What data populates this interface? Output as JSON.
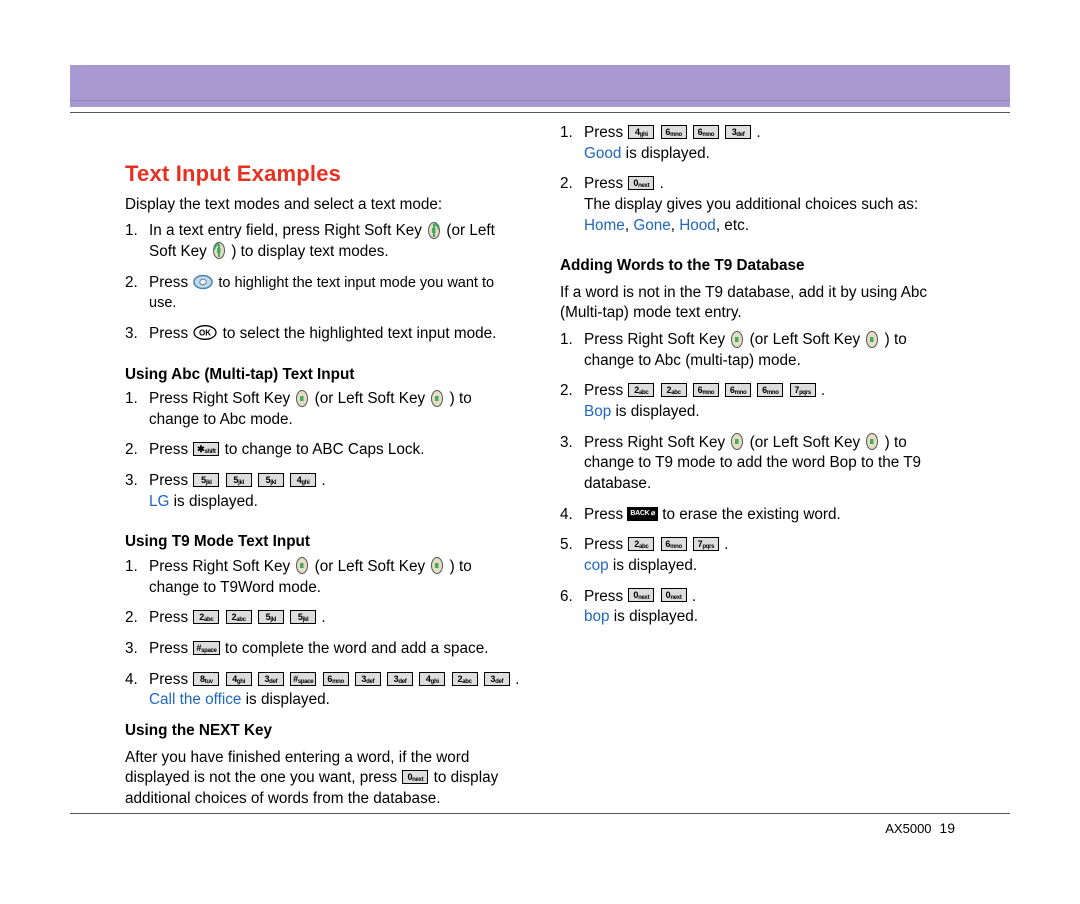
{
  "title": "Text Input Examples",
  "intro": "Display the text modes and select a text mode:",
  "step_text": {
    "in_text_entry_press_rsk": "In a text entry field, press Right Soft Key ",
    "or_left_soft_key": " (or Left Soft Key ",
    "to_display_text_modes": " ) to display text modes.",
    "press": "Press ",
    "to_highlight_mode": " to highlight the text input mode you want to use.",
    "to_select_mode": " to select the highlighted text input mode.",
    "press_rsk": "Press Right Soft Key ",
    "or_lsk": " (or Left Soft Key ",
    "to_abc_mode": " ) to change to Abc mode.",
    "to_abc_caps": " to change to ABC Caps Lock.",
    "lg_disp": " is displayed.",
    "to_t9word": " ) to change to T9Word mode.",
    "to_complete_word": " to complete the word and add a space.",
    "call_office_disp": " is displayed.",
    "after_finished": "After you have finished entering a word, if the word displayed is not the one you want, press ",
    "to_display_choices": " to display additional choices of words from the database.",
    "good_disp": " is displayed.",
    "addl_choices": "The display gives you additional choices such as:",
    "etc": ", etc.",
    "t9_add_intro": "If a word is not in the T9 database, add it by using Abc (Multi-tap) mode text entry.",
    "to_abc_multitap": " ) to change to Abc (multi-tap) mode.",
    "bop_disp": " is displayed.",
    "to_t9_bop": " ) to change to T9 mode to add the word Bop to the T9 database.",
    "to_erase": " to erase the existing word.",
    "cop_disp": " is displayed.",
    "bop_disp2": " is displayed.",
    "period": " ."
  },
  "colored_words": {
    "LG": "LG",
    "CallOffice": "Call the office",
    "Good": "Good",
    "Home": "Home",
    "Gone": "Gone",
    "Hood": "Hood",
    "Bop": "Bop",
    "cop": "cop",
    "bop": "bop"
  },
  "headings": {
    "abc": "Using Abc (Multi-tap) Text Input",
    "t9": "Using T9 Mode Text Input",
    "next": "Using the NEXT Key",
    "adding": "Adding Words to the T9 Database"
  },
  "footer": {
    "model": "AX5000",
    "page": "19"
  }
}
